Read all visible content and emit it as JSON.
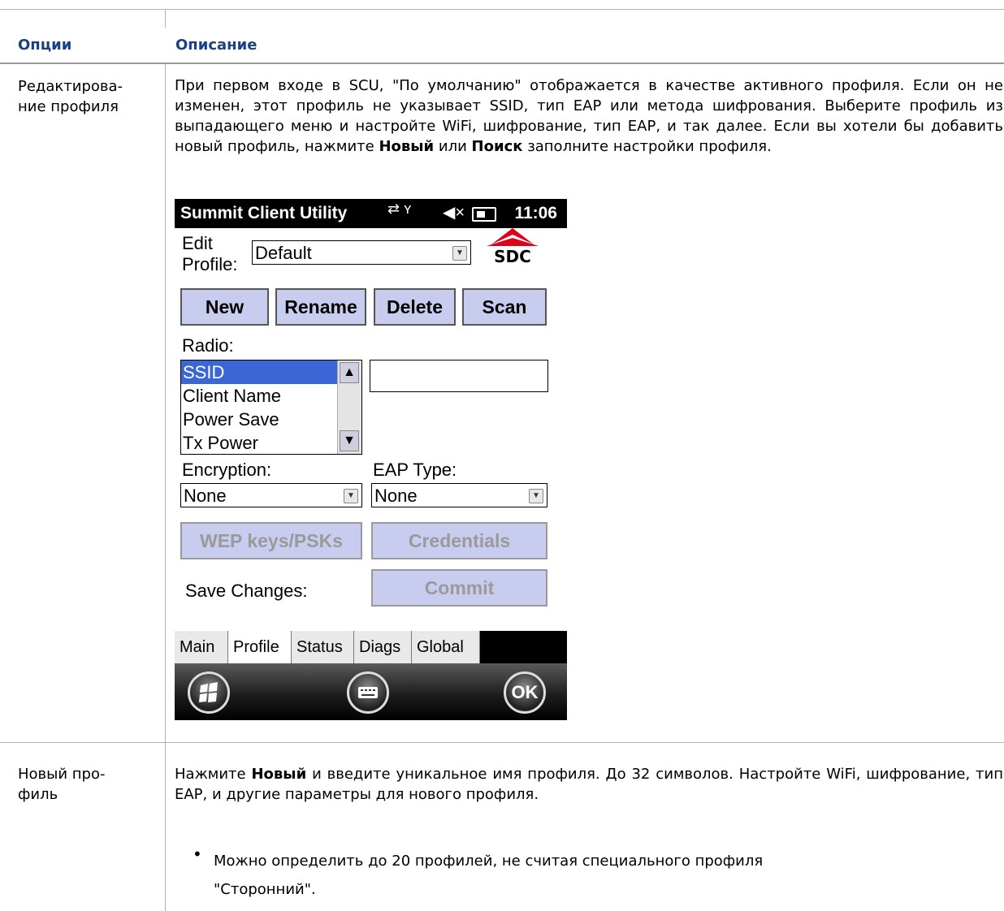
{
  "table": {
    "header": {
      "options": "Опции",
      "description": "Описание"
    },
    "rows": [
      {
        "option_line1": "Редактирова-",
        "option_line2": "ние профиля",
        "description_parts": {
          "text1": "При первом входе в SCU, \"По умолчанию\" отображается в качестве активного профиля. Если он не изменен, этот профиль не указывает SSID, тип EAP или метода шифрования. Выберите профиль из выпадающего меню и настройте WiFi, шифрование, тип EAP, и так далее. Если вы хотели бы добавить новый профиль, нажмите ",
          "bold1": "Новый",
          "text2": " или ",
          "bold2": "Поиск",
          "text3": " заполните настройки профиля."
        }
      },
      {
        "option_line1": "Новый про-",
        "option_line2": "филь",
        "description_parts": {
          "text1": "Нажмите ",
          "bold1": "Новый",
          "text2": " и введите уникальное имя профиля. До 32 символов. Настройте WiFi, шифрование, тип EAP, и другие параметры для нового профиля."
        },
        "bullet_line1": "Можно определить до 20 профилей, не считая специального профиля",
        "bullet_line2": "\"Сторонний\"."
      }
    ]
  },
  "device": {
    "status_bar": {
      "title": "Summit Client Utility",
      "time": "11:06"
    },
    "logo_text": "SDC",
    "edit_profile_label_line1": "Edit",
    "edit_profile_label_line2": "Profile:",
    "profile_value": "Default",
    "buttons": {
      "new": "New",
      "rename": "Rename",
      "delete": "Delete",
      "scan": "Scan"
    },
    "radio_label": "Radio:",
    "radio_items": [
      "SSID",
      "Client Name",
      "Power Save",
      "Tx Power"
    ],
    "encryption_label": "Encryption:",
    "encryption_value": "None",
    "eap_label": "EAP Type:",
    "eap_value": "None",
    "wep_button": "WEP keys/PSKs",
    "credentials_button": "Credentials",
    "save_changes_label": "Save Changes:",
    "commit_button": "Commit",
    "tabs": [
      "Main",
      "Profile",
      "Status",
      "Diags",
      "Global"
    ],
    "ok_label": "OK"
  }
}
